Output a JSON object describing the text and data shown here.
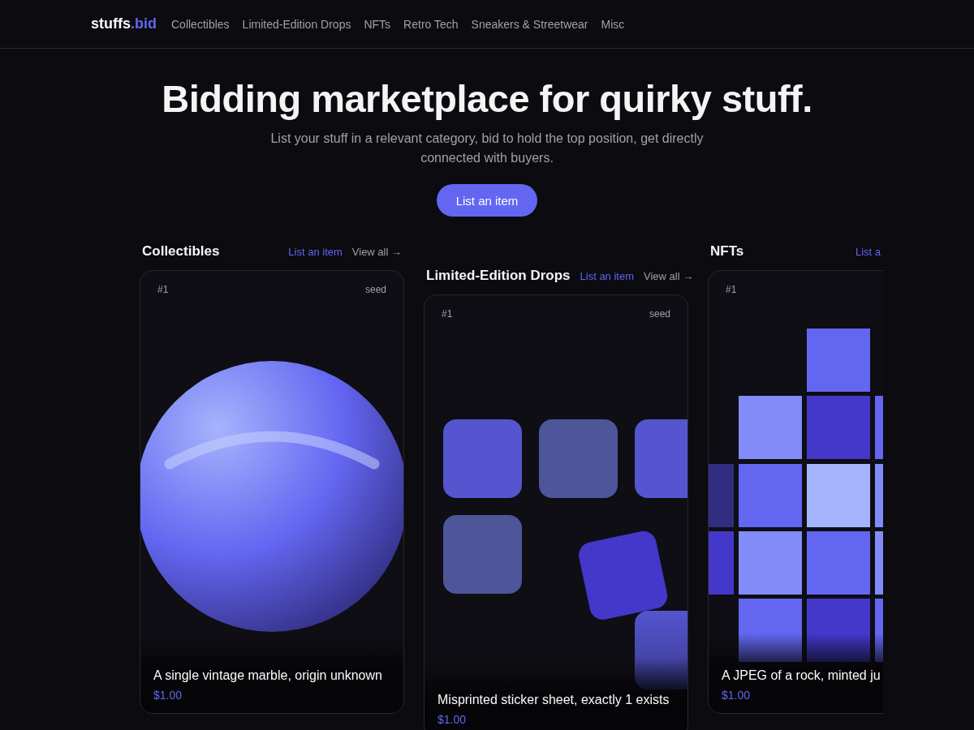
{
  "nav": {
    "logo": {
      "name": "stuffs",
      "tld": ".bid"
    },
    "links": [
      {
        "label": "Collectibles"
      },
      {
        "label": "Limited-Edition Drops"
      },
      {
        "label": "NFTs"
      },
      {
        "label": "Retro Tech"
      },
      {
        "label": "Sneakers & Streetwear"
      },
      {
        "label": "Misc"
      }
    ]
  },
  "hero": {
    "title": "Bidding marketplace for quirky stuff.",
    "subtitle": "List your stuff in a relevant category, bid to hold the top position, get directly connected with buyers.",
    "button": "List an item"
  },
  "categories": [
    {
      "title": "Collectibles",
      "list_link": "List an item",
      "view_all": "View all →",
      "card": {
        "rank": "#1",
        "tag": "seed",
        "kind": "marble",
        "title": "A single vintage marble, origin unknown",
        "price": "$1.00"
      }
    },
    {
      "title": "Limited-Edition Drops",
      "list_link": "List an item",
      "view_all": "View all →",
      "card": {
        "rank": "#1",
        "tag": "seed",
        "kind": "stickers",
        "title": "Misprinted sticker sheet, exactly 1 exists",
        "price": "$1.00"
      }
    },
    {
      "title": "NFTs",
      "list_link": "List a",
      "card": {
        "rank": "#1",
        "kind": "pixels",
        "title": "A JPEG of a rock, minted ju",
        "price": "$1.00"
      }
    }
  ]
}
